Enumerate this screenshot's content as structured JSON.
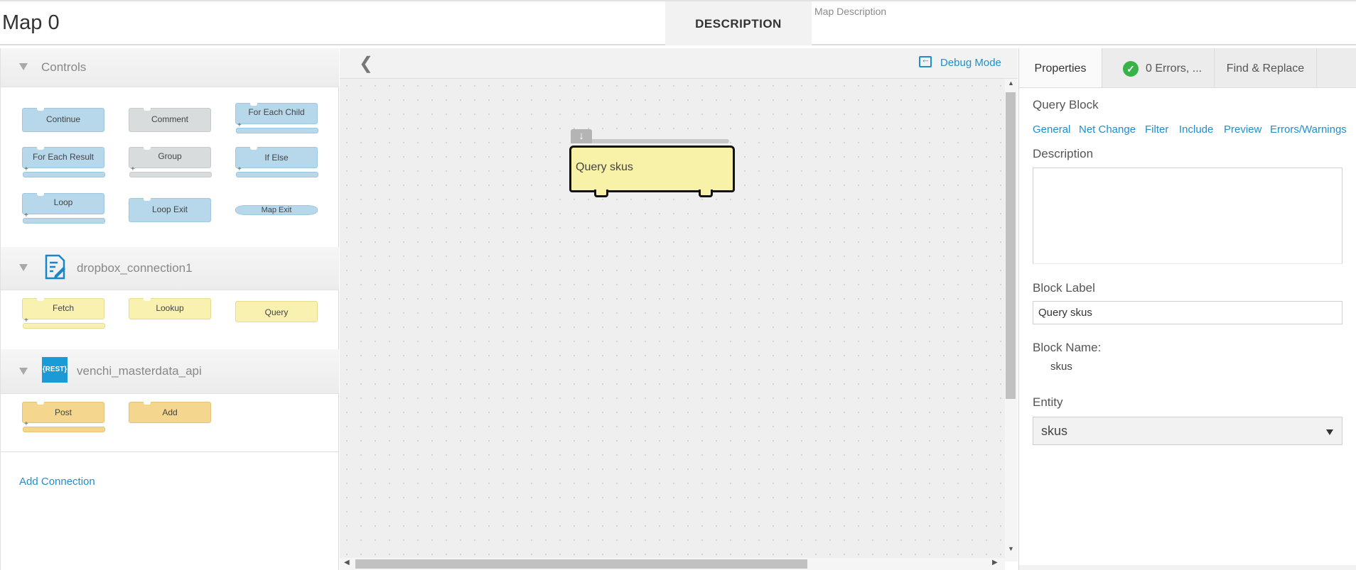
{
  "header": {
    "map_title": "Map 0",
    "description_label": "DESCRIPTION",
    "description_placeholder": "Map Description"
  },
  "palette": {
    "controls": {
      "title": "Controls",
      "blocks": [
        "Continue",
        "Comment",
        "For Each Child",
        "For Each Result",
        "Group",
        "If Else",
        "Loop",
        "Loop Exit",
        "Map Exit"
      ]
    },
    "dropbox": {
      "title": "dropbox_connection1",
      "icon": "document-edit-icon",
      "blocks": [
        "Fetch",
        "Lookup",
        "Query"
      ]
    },
    "rest": {
      "title": "venchi_masterdata_api",
      "icon_text": "{REST}",
      "blocks": [
        "Post",
        "Add"
      ]
    },
    "add_connection": "Add Connection"
  },
  "canvas": {
    "debug_mode": "Debug Mode",
    "query_block_label": "Query skus"
  },
  "right_panel": {
    "tabs": {
      "properties": "Properties",
      "errors": "0 Errors, ...",
      "find_replace": "Find & Replace"
    },
    "block_type": "Query Block",
    "links": [
      "General",
      "Net Change",
      "Filter",
      "Include",
      "Preview",
      "Errors/Warnings"
    ],
    "description_label": "Description",
    "block_label_title": "Block Label",
    "block_label_value": "Query skus",
    "block_name_title": "Block Name:",
    "block_name_value": "skus",
    "entity_title": "Entity",
    "entity_value": "skus"
  },
  "colors": {
    "accent": "#1e8fce",
    "control_block": "#b6d8ea",
    "connector_block": "#f8f1b0",
    "rest_block": "#f5d68f",
    "success": "#37b34a"
  }
}
